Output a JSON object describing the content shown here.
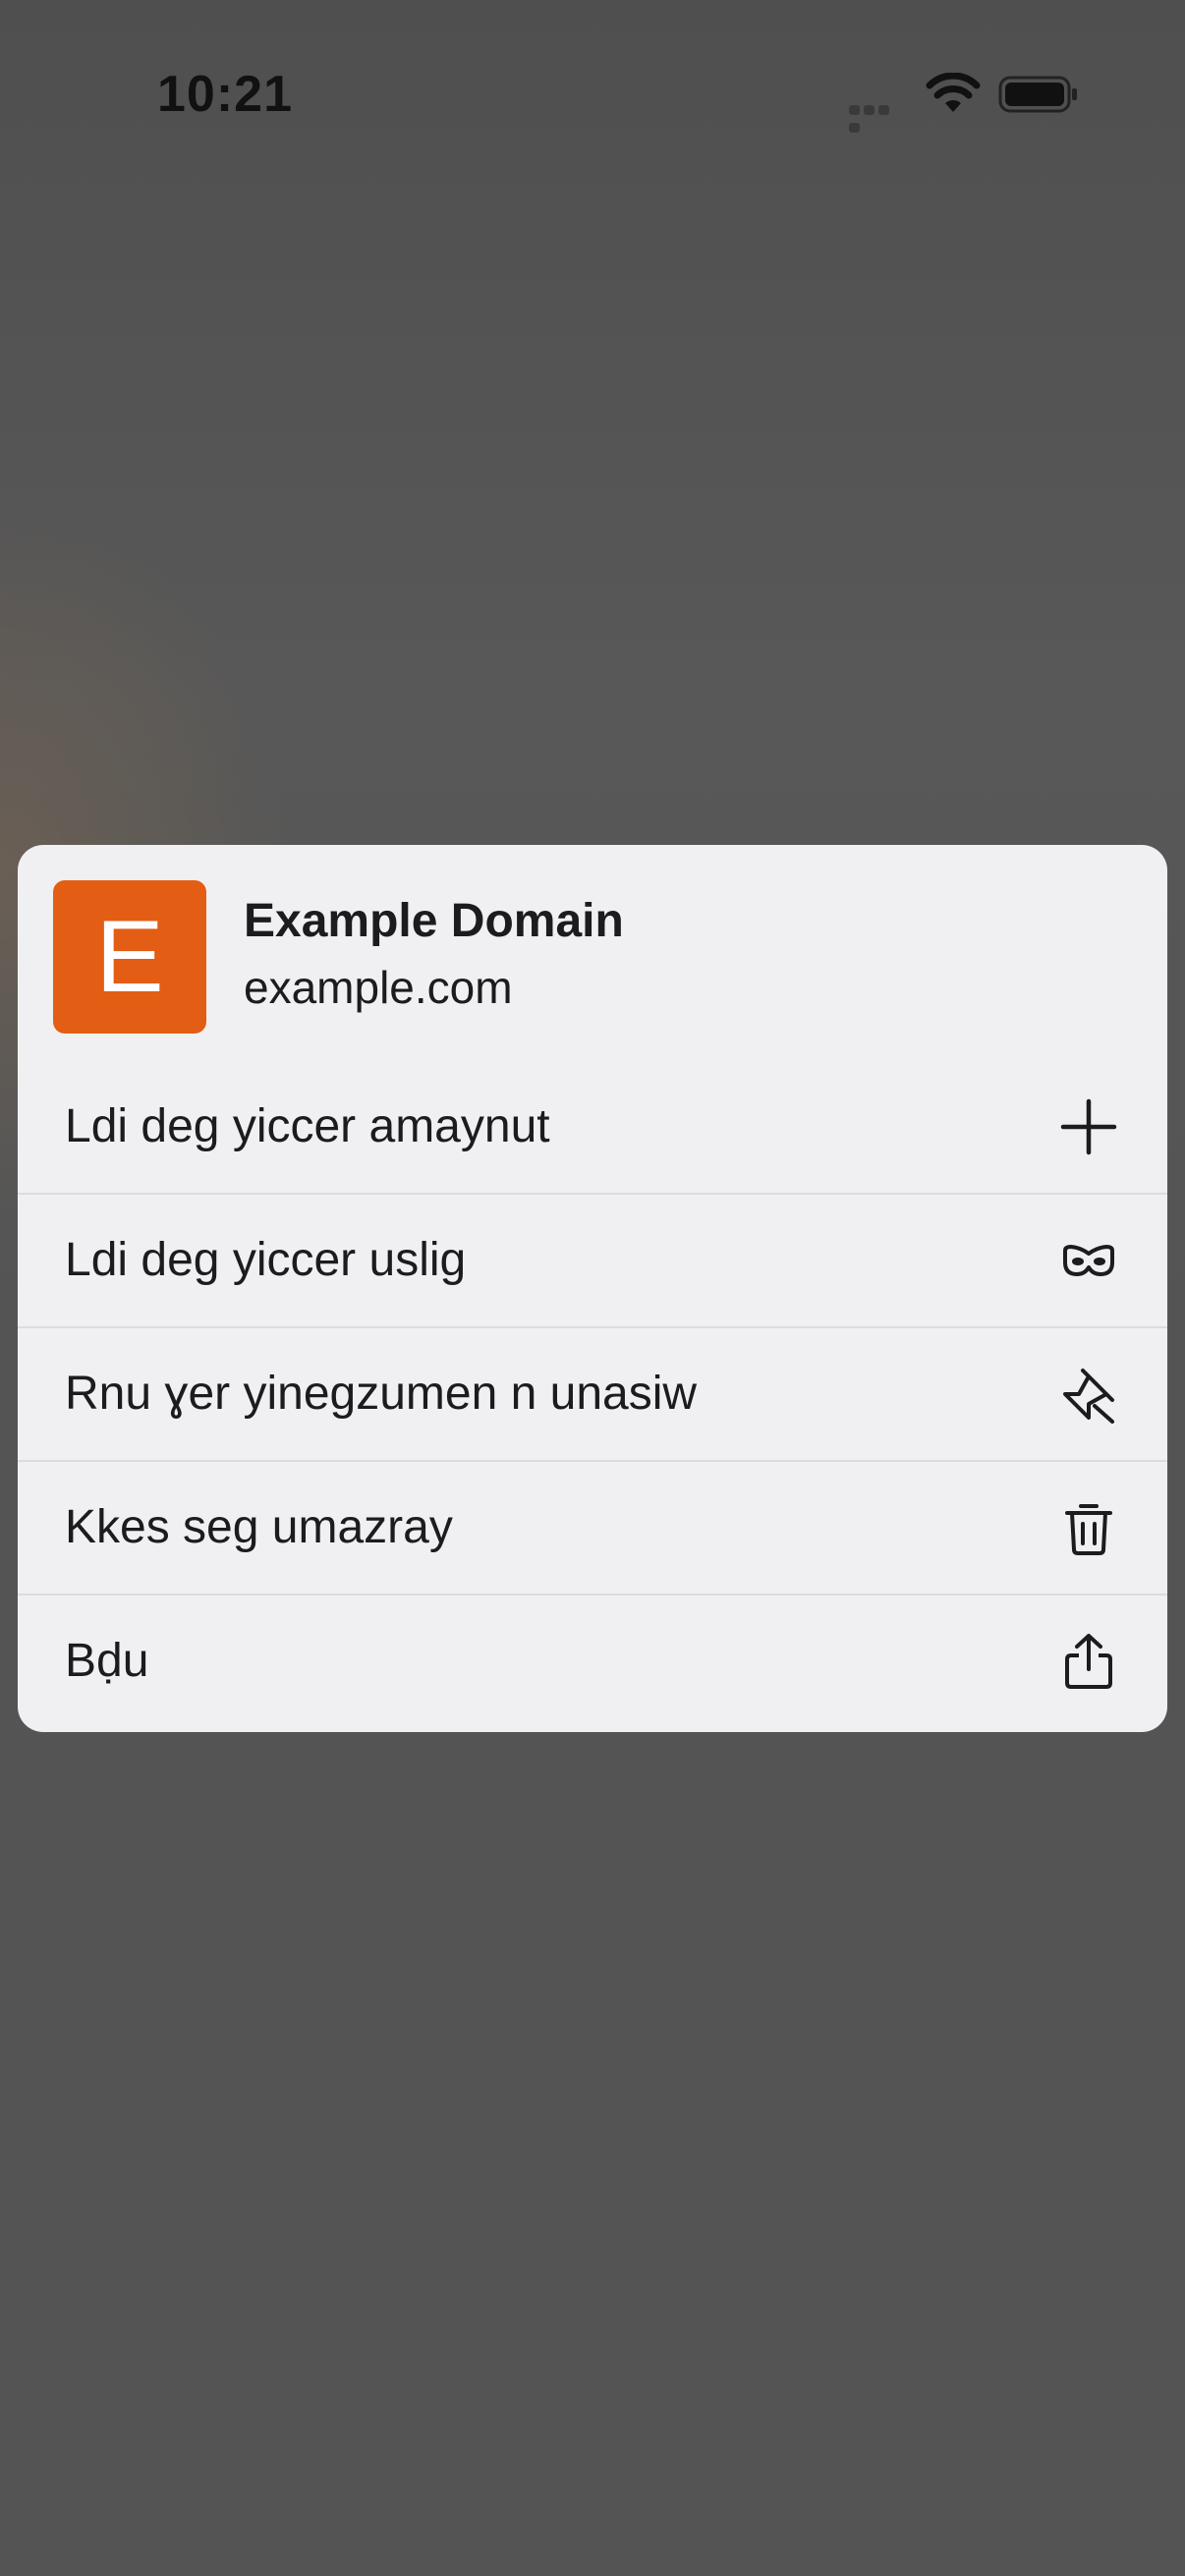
{
  "status_bar": {
    "time": "10:21"
  },
  "context_menu": {
    "site": {
      "badge_letter": "E",
      "badge_color": "#e35d14",
      "title": "Example Domain",
      "domain": "example.com"
    },
    "items": [
      {
        "label": "Ldi deg yiccer amaynut",
        "icon": "plus-icon"
      },
      {
        "label": "Ldi deg yiccer uslig",
        "icon": "private-mask-icon"
      },
      {
        "label": "Rnu ɣer yinegzumen n unasiw",
        "icon": "pin-icon"
      },
      {
        "label": "Kkes seg umazray",
        "icon": "trash-icon"
      },
      {
        "label": "Bḍu",
        "icon": "share-icon"
      }
    ]
  }
}
